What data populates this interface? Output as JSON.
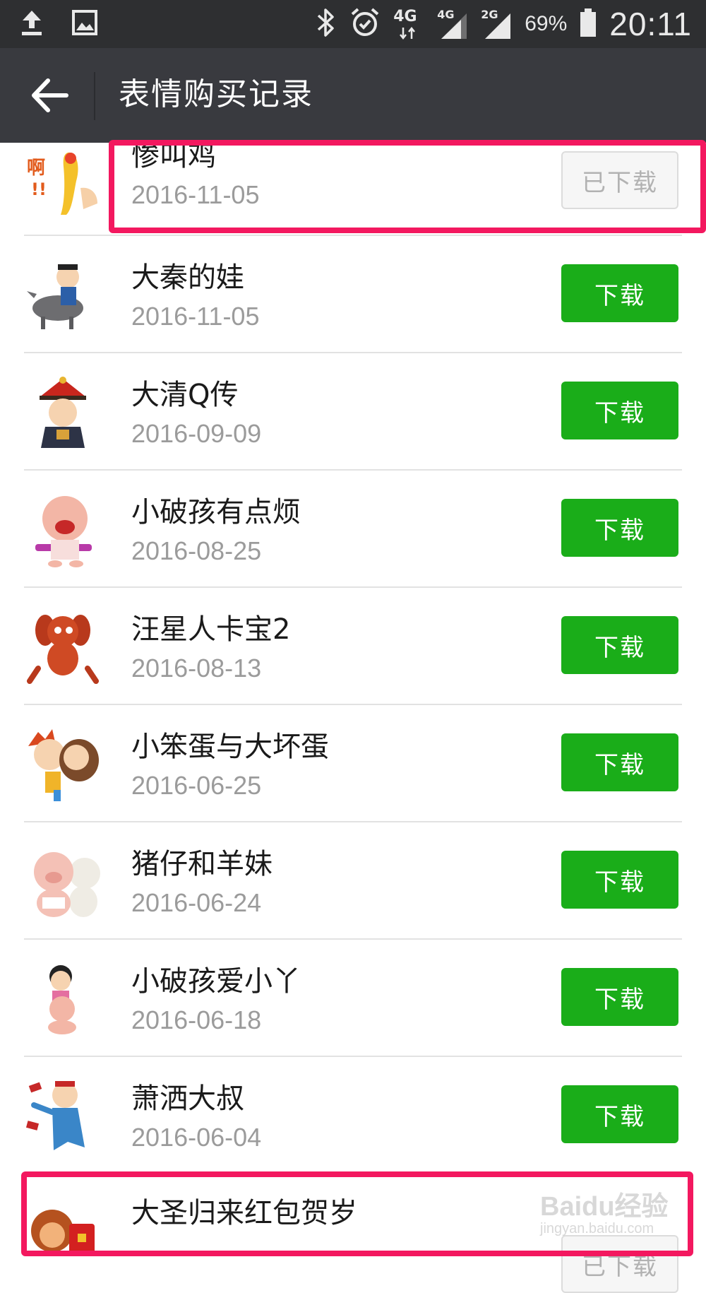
{
  "status_bar": {
    "network_label": "4G",
    "sim1_label": "4G",
    "sim2_label": "2G",
    "battery_text": "69%",
    "time": "20:11",
    "icons": [
      "upload-icon",
      "image-icon",
      "bluetooth-icon",
      "alarm-icon",
      "signal-icon",
      "battery-icon"
    ]
  },
  "app_bar": {
    "title": "表情购买记录",
    "back_icon": "back-arrow-icon"
  },
  "items": [
    {
      "name": "惨叫鸡",
      "date": "2016-11-05",
      "button": "已下载",
      "downloaded": true,
      "highlighted": true
    },
    {
      "name": "大秦的娃",
      "date": "2016-11-05",
      "button": "下载",
      "downloaded": false
    },
    {
      "name": "大清Q传",
      "date": "2016-09-09",
      "button": "下载",
      "downloaded": false
    },
    {
      "name": "小破孩有点烦",
      "date": "2016-08-25",
      "button": "下载",
      "downloaded": false
    },
    {
      "name": "汪星人卡宝2",
      "date": "2016-08-13",
      "button": "下载",
      "downloaded": false
    },
    {
      "name": "小笨蛋与大坏蛋",
      "date": "2016-06-25",
      "button": "下载",
      "downloaded": false
    },
    {
      "name": "猪仔和羊妹",
      "date": "2016-06-24",
      "button": "下载",
      "downloaded": false
    },
    {
      "name": "小破孩爱小丫",
      "date": "2016-06-18",
      "button": "下载",
      "downloaded": false
    },
    {
      "name": "萧洒大叔",
      "date": "2016-06-04",
      "button": "下载",
      "downloaded": false
    },
    {
      "name": "大圣归来红包贺岁",
      "date": "",
      "button": "已下载",
      "downloaded": true,
      "highlighted": true
    }
  ],
  "colors": {
    "accent_green": "#1aad19",
    "highlight": "#f3185f"
  },
  "watermark": {
    "brand": "Baidu经验",
    "url": "jingyan.baidu.com"
  }
}
